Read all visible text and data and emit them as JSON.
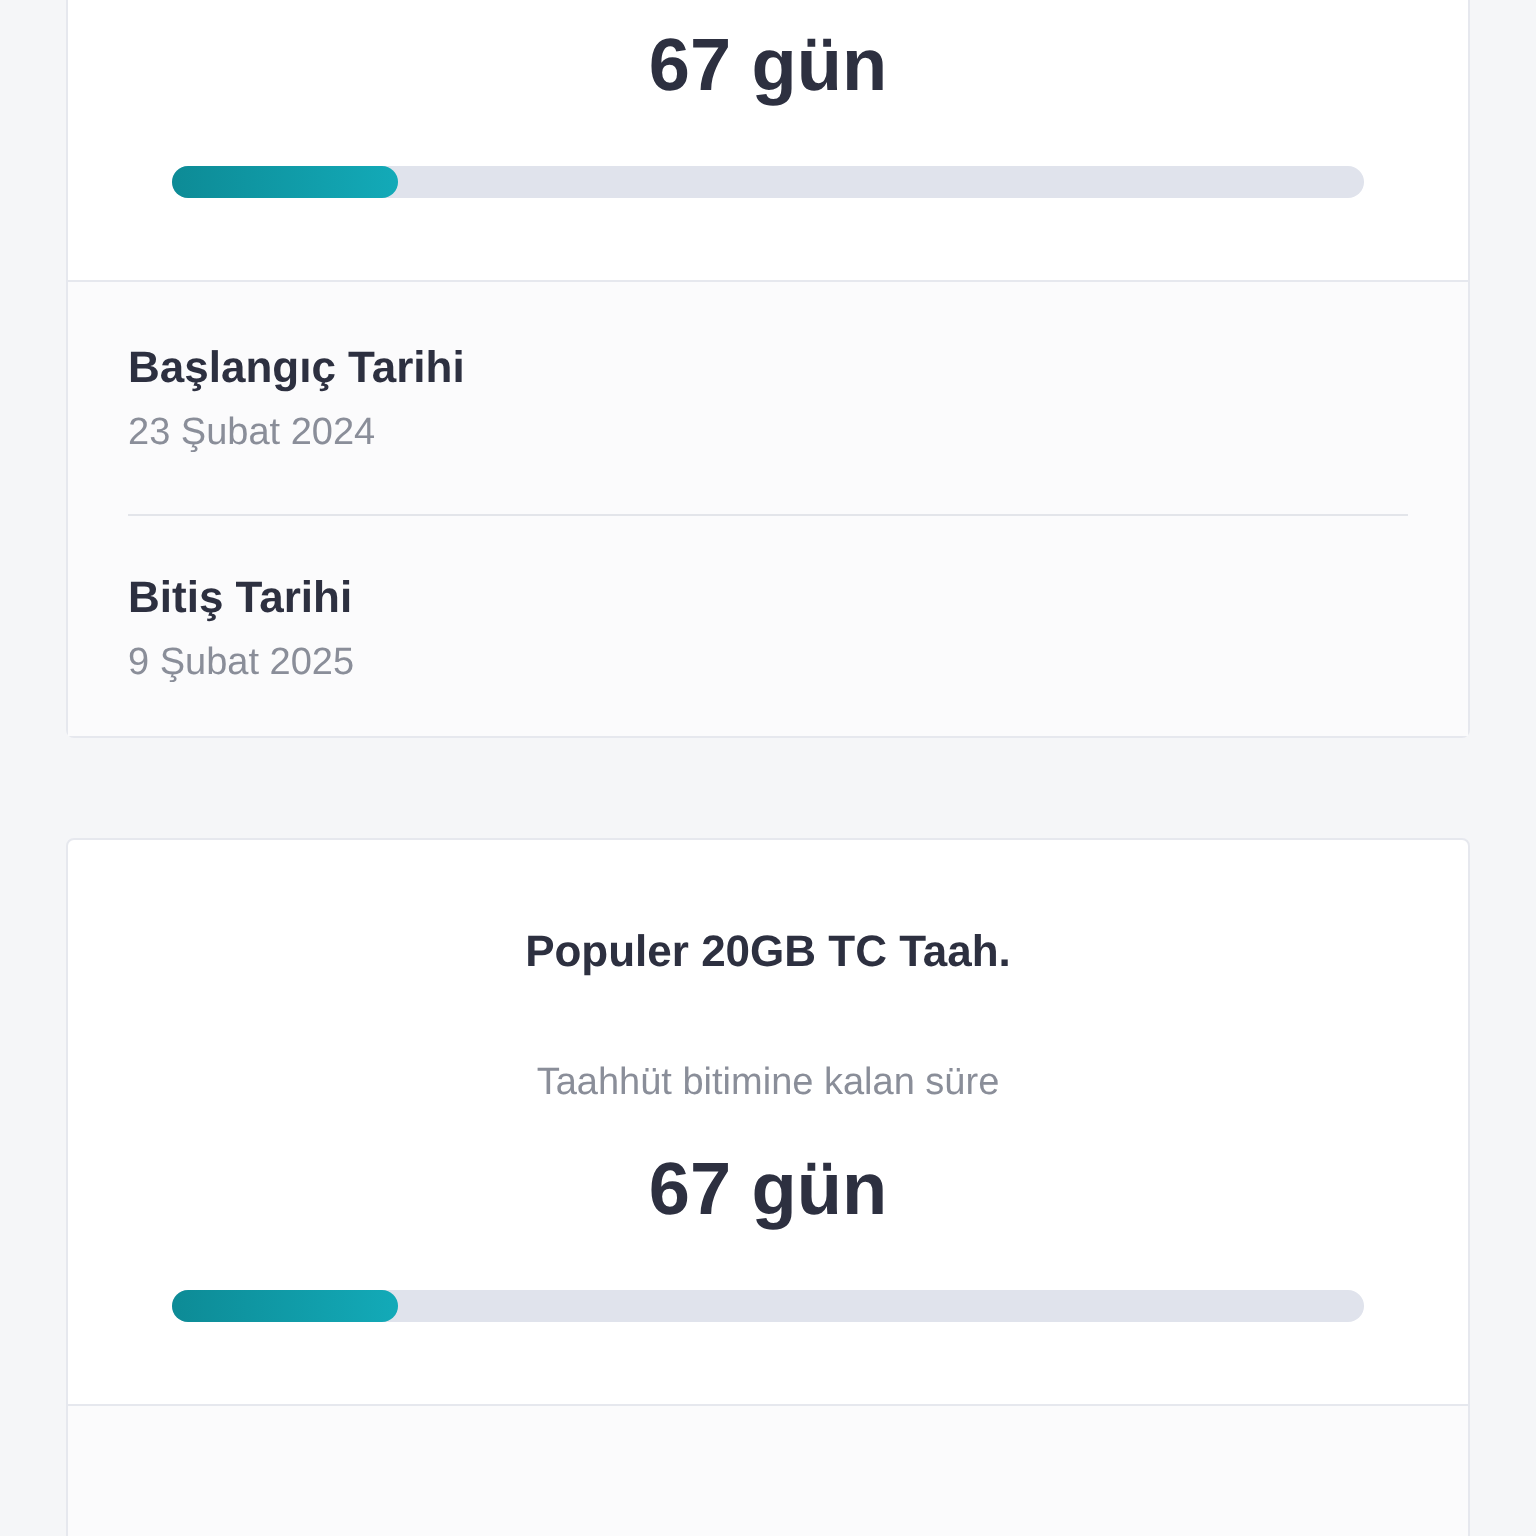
{
  "plans": [
    {
      "days": "67 gün",
      "level": 0.19,
      "dates": [
        {
          "label": "Başlangıç Tarihi",
          "value": "23 Şubat 2024"
        },
        {
          "label": "Bitiş Tarihi",
          "value": "9 Şubat 2025"
        }
      ]
    },
    {
      "title": "Populer 20GB TC Taah.",
      "subtitle": "Taahhüt bitimine kalan süre",
      "days": "67 gün",
      "level": 0.19
    }
  ]
}
